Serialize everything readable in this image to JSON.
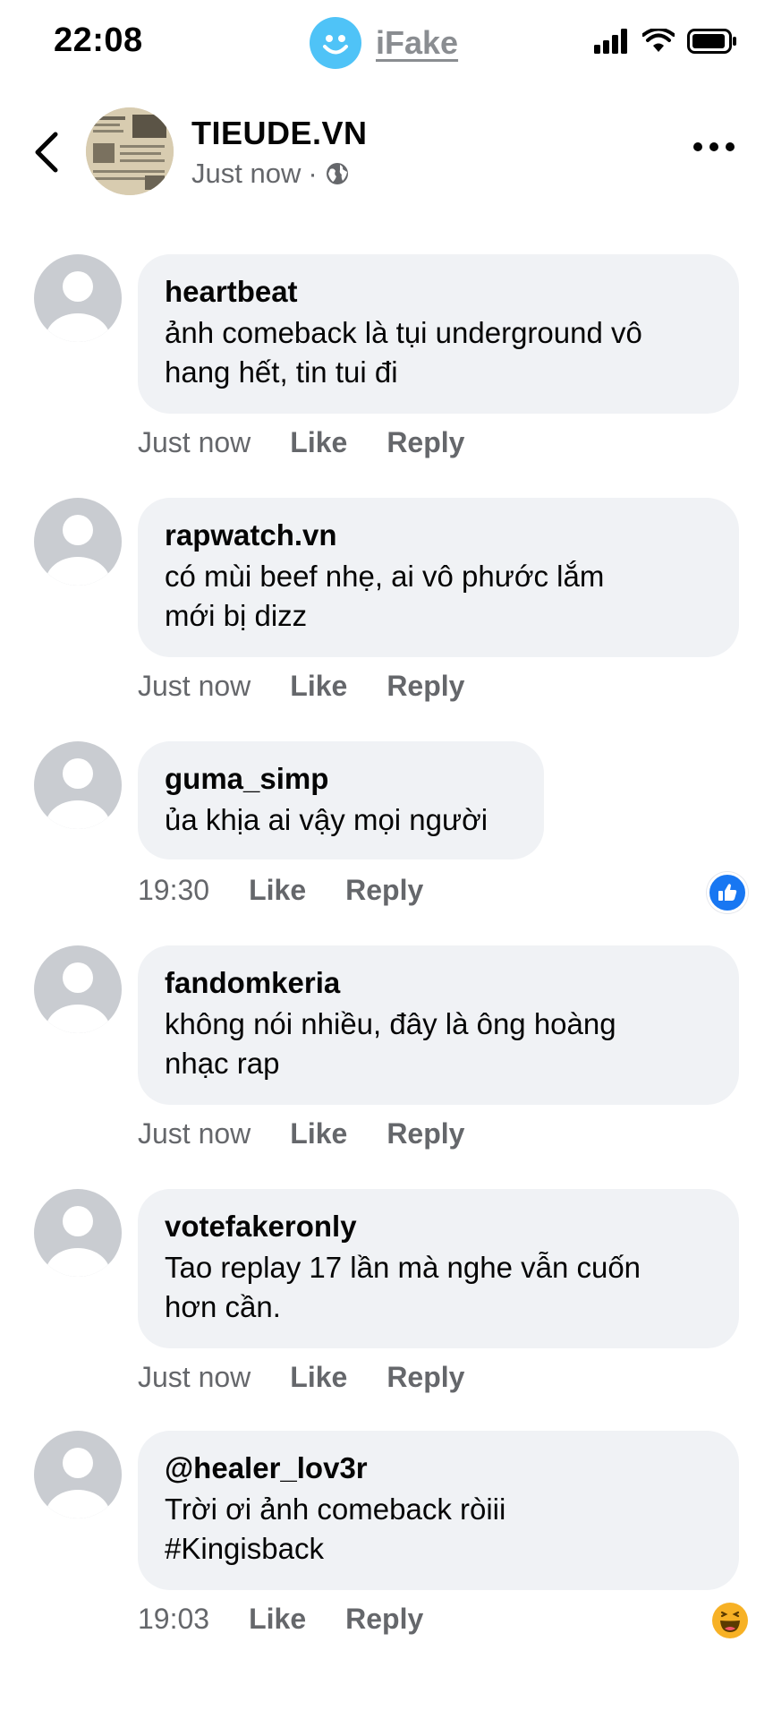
{
  "status_bar": {
    "time": "22:08",
    "app_label": "iFake"
  },
  "header": {
    "page_name": "TIEUDE.VN",
    "timestamp": "Just now",
    "separator": "·"
  },
  "comments": [
    {
      "author": "heartbeat",
      "text": "ảnh comeback là tụi underground vô\nhang hết, tin tui đi",
      "time": "Just now",
      "like": "Like",
      "reply": "Reply",
      "reaction": ""
    },
    {
      "author": "rapwatch.vn",
      "text": "có mùi beef nhẹ, ai vô phước lắm\nmới bị dizz",
      "time": "Just now",
      "like": "Like",
      "reply": "Reply",
      "reaction": ""
    },
    {
      "author": "guma_simp",
      "text": "ủa khịa ai vậy mọi người",
      "time": "19:30",
      "like": "Like",
      "reply": "Reply",
      "reaction": "like-reaction-icon"
    },
    {
      "author": "fandomkeria",
      "text": "không nói nhiều, đây là ông hoàng\nnhạc rap",
      "time": "Just now",
      "like": "Like",
      "reply": "Reply",
      "reaction": ""
    },
    {
      "author": "votefakeronly",
      "text": "Tao replay 17 lần mà nghe vẫn cuốn\nhơn cần.",
      "time": "Just now",
      "like": "Like",
      "reply": "Reply",
      "reaction": ""
    },
    {
      "author": "@healer_lov3r",
      "text": "Trời ơi ảnh comeback ròiii\n#Kingisback",
      "time": "19:03",
      "like": "Like",
      "reply": "Reply",
      "reaction": "haha-reaction-icon"
    }
  ],
  "colors": {
    "bubble": "#f0f2f5",
    "secondary_text": "#65676b",
    "like_blue": "#1877f2",
    "haha_yellow": "#f7b125",
    "ifake_blue": "#4fc3f7"
  }
}
